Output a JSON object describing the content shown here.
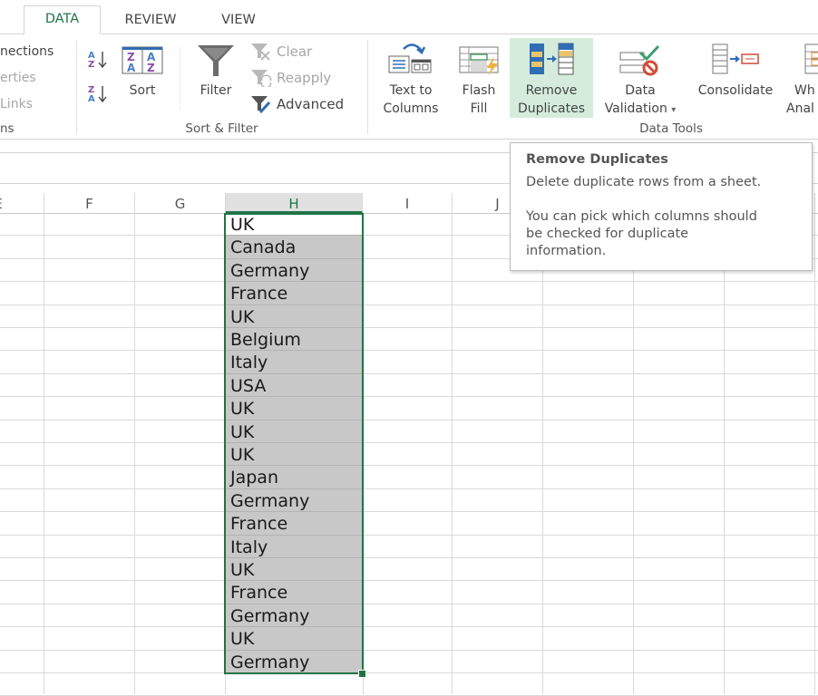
{
  "tabs": [
    {
      "label": "DATA",
      "active": true
    },
    {
      "label": "REVIEW",
      "active": false
    },
    {
      "label": "VIEW",
      "active": false
    }
  ],
  "ribbon": {
    "connections_group": {
      "label_partial": "ns",
      "items": [
        {
          "label": "nections",
          "enabled": true
        },
        {
          "label": "erties",
          "enabled": false
        },
        {
          "label": "Links",
          "enabled": false
        }
      ]
    },
    "sort_filter_group": {
      "label": "Sort & Filter",
      "sort_asc_icon": "sort-a-to-z-icon",
      "sort_desc_icon": "sort-z-to-a-icon",
      "sort_label": "Sort",
      "filter_label": "Filter",
      "clear_label": "Clear",
      "reapply_label": "Reapply",
      "advanced_label": "Advanced",
      "clear_enabled": false,
      "reapply_enabled": false
    },
    "data_tools_group": {
      "label": "Data Tools",
      "buttons": [
        {
          "line1": "Text to",
          "line2": "Columns",
          "icon": "text-to-columns-icon"
        },
        {
          "line1": "Flash",
          "line2": "Fill",
          "icon": "flash-fill-icon"
        },
        {
          "line1": "Remove",
          "line2": "Duplicates",
          "icon": "remove-duplicates-icon",
          "highlighted": true
        },
        {
          "line1": "Data",
          "line2": "Validation",
          "icon": "data-validation-icon",
          "dropdown": "▾"
        },
        {
          "line1": "Consolidate",
          "line2": "",
          "icon": "consolidate-icon"
        },
        {
          "line1": "Wh",
          "line2": "Anal",
          "icon": "what-if-analysis-icon"
        }
      ]
    }
  },
  "sheet": {
    "columns": [
      "E",
      "F",
      "G",
      "H",
      "I",
      "J",
      "",
      "",
      ""
    ],
    "selected_column": "H",
    "column_h_values": [
      "UK",
      "Canada",
      "Germany",
      "France",
      "UK",
      "Belgium",
      "Italy",
      "USA",
      "UK",
      "UK",
      "UK",
      "Japan",
      "Germany",
      "France",
      "Italy",
      "UK",
      "France",
      "Germany",
      "UK",
      "Germany"
    ],
    "accent_color": "#217346",
    "selection_fill": "#c8c8c8"
  },
  "tooltip": {
    "title": "Remove Duplicates",
    "line1": "Delete duplicate rows from a sheet.",
    "body_lines": [
      "You can pick which columns should",
      "be checked for duplicate",
      "information."
    ]
  }
}
